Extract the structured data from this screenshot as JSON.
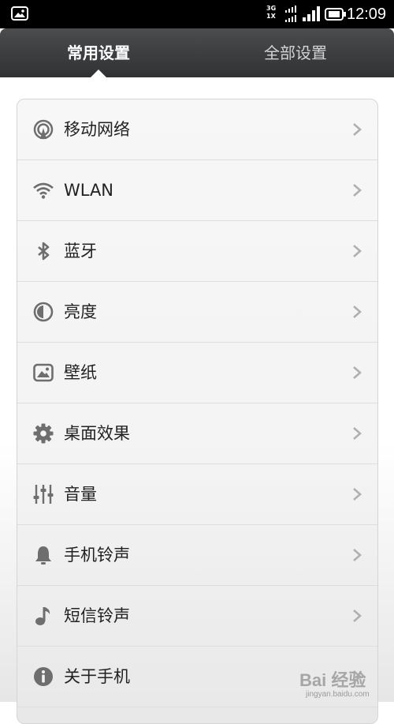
{
  "status_bar": {
    "network_top": "3G",
    "network_bottom": "1X",
    "time": "12:09"
  },
  "tabs": {
    "active_label": "常用设置",
    "inactive_label": "全部设置"
  },
  "settings": [
    {
      "label": "移动网络",
      "icon": "mobile-network-icon"
    },
    {
      "label": "WLAN",
      "icon": "wifi-icon"
    },
    {
      "label": "蓝牙",
      "icon": "bluetooth-icon"
    },
    {
      "label": "亮度",
      "icon": "brightness-icon"
    },
    {
      "label": "壁纸",
      "icon": "wallpaper-icon"
    },
    {
      "label": "桌面效果",
      "icon": "gear-icon"
    },
    {
      "label": "音量",
      "icon": "volume-sliders-icon"
    },
    {
      "label": "手机铃声",
      "icon": "bell-icon"
    },
    {
      "label": "短信铃声",
      "icon": "music-note-icon"
    },
    {
      "label": "关于手机",
      "icon": "info-icon"
    }
  ],
  "watermark": {
    "text": "Bai 经验",
    "sub": "jingyan.baidu.com"
  },
  "colors": {
    "header_dark": "#2f3133",
    "icon_gray": "#6e6e6e",
    "chevron_gray": "#b0b0b0"
  }
}
